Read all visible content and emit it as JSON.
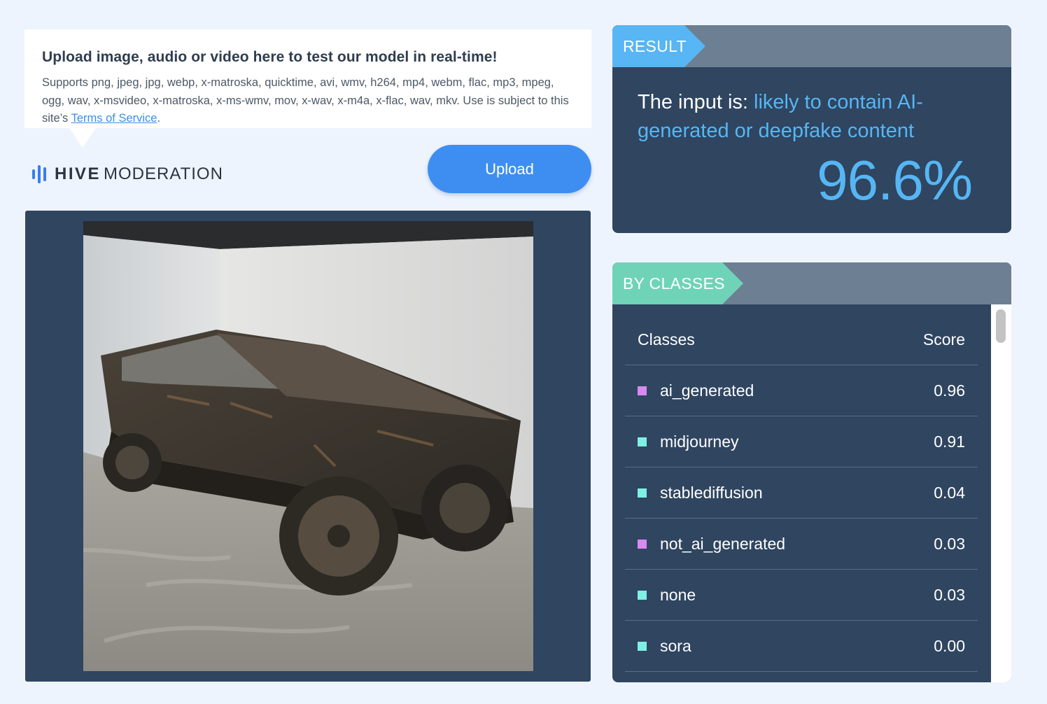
{
  "upload_info": {
    "title": "Upload image, audio or video here to test our model in real-time!",
    "supports_text": "Supports png, jpeg, jpg, webp, x-matroska, quicktime, avi, wmv, h264, mp4, webm, flac, mp3, mpeg, ogg, wav, x-msvideo, x-matroska, x-ms-wmv, mov, x-wav, x-m4a, x-flac, wav, mkv. Use is subject to this site’s ",
    "terms_link": "Terms of Service",
    "terms_suffix": "."
  },
  "brand": {
    "name_bold": "HIVE",
    "name_light": "MODERATION",
    "icon": "hive-bars-icon",
    "color": "#3a7df0"
  },
  "upload_button": {
    "label": "Upload",
    "color": "#3e8ef2"
  },
  "result": {
    "tab_label": "RESULT",
    "prefix": "The input is: ",
    "verdict": "likely to contain AI-generated or deepfake content",
    "percentage": "96.6%",
    "accent_color": "#56b6f4"
  },
  "by_classes": {
    "tab_label": "BY CLASSES",
    "col_classes": "Classes",
    "col_score": "Score",
    "rows": [
      {
        "name": "ai_generated",
        "score": "0.96",
        "color": "#d88af0"
      },
      {
        "name": "midjourney",
        "score": "0.91",
        "color": "#7ff0e4"
      },
      {
        "name": "stablediffusion",
        "score": "0.04",
        "color": "#7ff0e4"
      },
      {
        "name": "not_ai_generated",
        "score": "0.03",
        "color": "#d88af0"
      },
      {
        "name": "none",
        "score": "0.03",
        "color": "#7ff0e4"
      },
      {
        "name": "sora",
        "score": "0.00",
        "color": "#7ff0e4"
      }
    ]
  }
}
